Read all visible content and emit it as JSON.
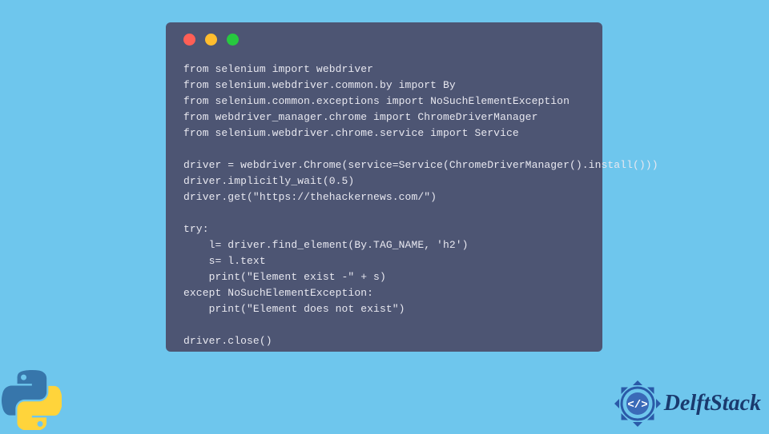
{
  "code": {
    "lines": [
      "from selenium import webdriver",
      "from selenium.webdriver.common.by import By",
      "from selenium.common.exceptions import NoSuchElementException",
      "from webdriver_manager.chrome import ChromeDriverManager",
      "from selenium.webdriver.chrome.service import Service",
      "",
      "driver = webdriver.Chrome(service=Service(ChromeDriverManager().install()))",
      "driver.implicitly_wait(0.5)",
      "driver.get(\"https://thehackernews.com/\")",
      "",
      "try:",
      "    l= driver.find_element(By.TAG_NAME, 'h2')",
      "    s= l.text",
      "    print(\"Element exist -\" + s)",
      "except NoSuchElementException:",
      "    print(\"Element does not exist\")",
      "",
      "driver.close()"
    ]
  },
  "branding": {
    "site_name": "DelftStack"
  }
}
